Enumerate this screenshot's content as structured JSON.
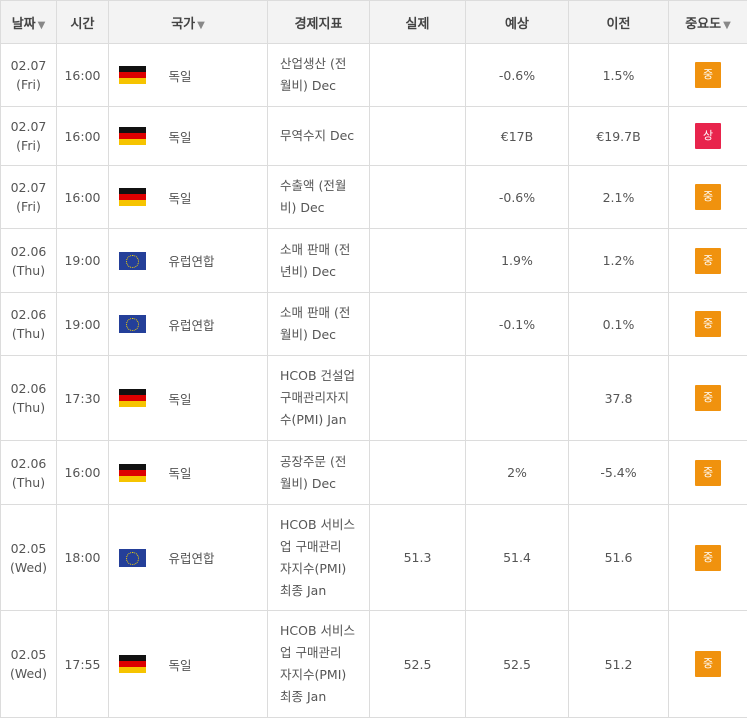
{
  "headers": {
    "date": "날짜",
    "time": "시간",
    "country": "국가",
    "indicator": "경제지표",
    "actual": "실제",
    "forecast": "예상",
    "previous": "이전",
    "importance": "중요도"
  },
  "sort_arrow": "▼",
  "rows": [
    {
      "date": "02.07",
      "day": "(Fri)",
      "time": "16:00",
      "flag": "germany-flag",
      "country": "독일",
      "indicator": [
        "산업생산 (전",
        "월비) Dec"
      ],
      "actual": "",
      "forecast": "-0.6%",
      "previous": "1.5%",
      "importance": "중",
      "level": "mid"
    },
    {
      "date": "02.07",
      "day": "(Fri)",
      "time": "16:00",
      "flag": "germany-flag",
      "country": "독일",
      "indicator": [
        "무역수지 Dec"
      ],
      "actual": "",
      "forecast": "€17B",
      "previous": "€19.7B",
      "importance": "상",
      "level": "high"
    },
    {
      "date": "02.07",
      "day": "(Fri)",
      "time": "16:00",
      "flag": "germany-flag",
      "country": "독일",
      "indicator": [
        "수출액 (전월",
        "비) Dec"
      ],
      "actual": "",
      "forecast": "-0.6%",
      "previous": "2.1%",
      "importance": "중",
      "level": "mid"
    },
    {
      "date": "02.06",
      "day": "(Thu)",
      "time": "19:00",
      "flag": "eu-flag",
      "country": "유럽연합",
      "indicator": [
        "소매 판매 (전",
        "년비) Dec"
      ],
      "actual": "",
      "forecast": "1.9%",
      "previous": "1.2%",
      "importance": "중",
      "level": "mid"
    },
    {
      "date": "02.06",
      "day": "(Thu)",
      "time": "19:00",
      "flag": "eu-flag",
      "country": "유럽연합",
      "indicator": [
        "소매 판매 (전",
        "월비) Dec"
      ],
      "actual": "",
      "forecast": "-0.1%",
      "previous": "0.1%",
      "importance": "중",
      "level": "mid"
    },
    {
      "date": "02.06",
      "day": "(Thu)",
      "time": "17:30",
      "flag": "germany-flag",
      "country": "독일",
      "indicator": [
        "HCOB 건설업",
        "구매관리자지",
        "수(PMI) Jan"
      ],
      "actual": "",
      "forecast": "",
      "previous": "37.8",
      "importance": "중",
      "level": "mid"
    },
    {
      "date": "02.06",
      "day": "(Thu)",
      "time": "16:00",
      "flag": "germany-flag",
      "country": "독일",
      "indicator": [
        "공장주문 (전",
        "월비) Dec"
      ],
      "actual": "",
      "forecast": "2%",
      "previous": "-5.4%",
      "importance": "중",
      "level": "mid"
    },
    {
      "date": "02.05",
      "day": "(Wed)",
      "time": "18:00",
      "flag": "eu-flag",
      "country": "유럽연합",
      "indicator": [
        "HCOB 서비스",
        "업 구매관리",
        "자지수(PMI)",
        "최종 Jan"
      ],
      "actual": "51.3",
      "forecast": "51.4",
      "previous": "51.6",
      "importance": "중",
      "level": "mid"
    },
    {
      "date": "02.05",
      "day": "(Wed)",
      "time": "17:55",
      "flag": "germany-flag",
      "country": "독일",
      "indicator": [
        "HCOB 서비스",
        "업 구매관리",
        "자지수(PMI)",
        "최종 Jan"
      ],
      "actual": "52.5",
      "forecast": "52.5",
      "previous": "51.2",
      "importance": "중",
      "level": "mid"
    }
  ],
  "colors": {
    "importance_mid": "#f0920e",
    "importance_high": "#e8244c",
    "header_bg": "#f3f3f3"
  }
}
